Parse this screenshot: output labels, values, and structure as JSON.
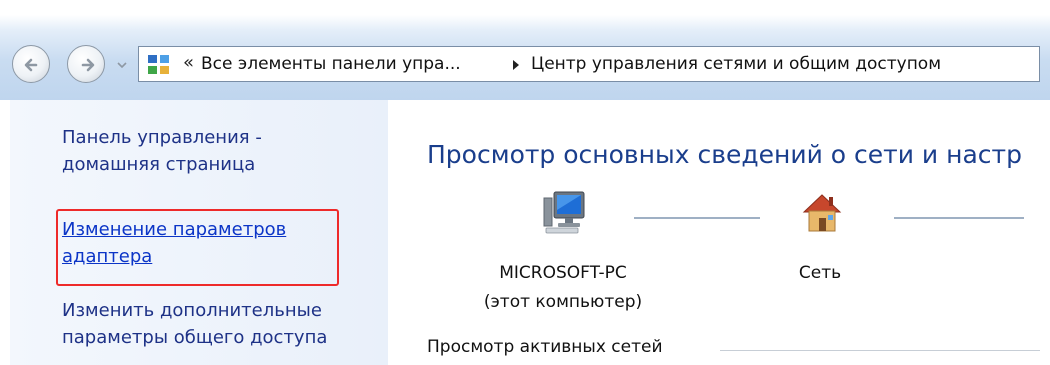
{
  "addressbar": {
    "overflow_glyph": "«",
    "crumb1": "Все элементы панели упра...",
    "crumb2": "Центр управления сетями и общим доступом",
    "icons": [
      "back-icon",
      "forward-icon",
      "recent-pages-icon",
      "control-panel-icon",
      "breadcrumb-arrow-icon"
    ]
  },
  "sidebar": {
    "home_line1": "Панель управления -",
    "home_line2": "домашняя страница",
    "adapter_line1": "Изменение параметров",
    "adapter_line2": "адаптера",
    "sharing_line1": "Изменить дополнительные",
    "sharing_line2": "параметры общего доступа",
    "highlight_color": "#ee2a2a"
  },
  "main": {
    "title": "Просмотр основных сведений о сети и настр",
    "computer_name": "MICROSOFT-PC",
    "computer_sub": "(этот компьютер)",
    "network_name": "Сеть",
    "active_networks": "Просмотр активных сетей",
    "icons": [
      "computer-icon",
      "house-icon"
    ]
  },
  "colors": {
    "link": "#1e3287",
    "title": "#1a3e8c"
  }
}
